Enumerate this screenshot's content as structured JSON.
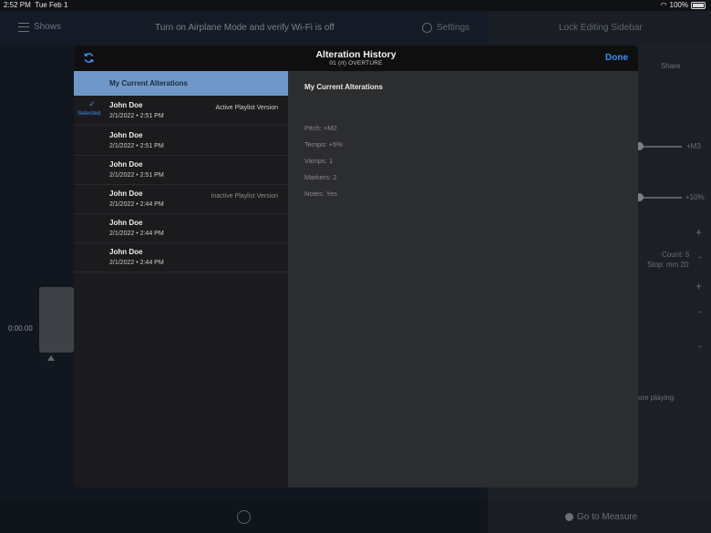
{
  "status": {
    "time": "2:52 PM",
    "date": "Tue Feb 1",
    "battery": "100%"
  },
  "topbar": {
    "shows_label": "Shows",
    "warning": "Turn on Airplane Mode and verify Wi-Fi is off",
    "settings_label": "Settings",
    "lock_label": "Lock Editing Sidebar"
  },
  "background": {
    "time_code": "0:00.00",
    "share_label": "Share",
    "pitch_value": "+M3",
    "tempo_value": "+10%",
    "count_label": "Count:",
    "count_value": "5",
    "stop_label": "Stop:",
    "stop_value": "mm 20",
    "before_playing": "ore playing",
    "go_to_measure": "Go to Measure"
  },
  "modal": {
    "title": "Alteration History",
    "subtitle": "01 (rt) OVERTURE",
    "done_label": "Done",
    "current_label": "My Current Alterations",
    "selected_label": "Selected",
    "rows": [
      {
        "name": "John Doe",
        "date": "2/1/2022 • 2:51 PM",
        "tag": "Active Playlist Version"
      },
      {
        "name": "John Doe",
        "date": "2/1/2022 • 2:51 PM",
        "tag": ""
      },
      {
        "name": "John Doe",
        "date": "2/1/2022 • 2:51 PM",
        "tag": ""
      },
      {
        "name": "John Doe",
        "date": "2/1/2022 • 2:44 PM",
        "tag": "Inactive Playlist Version"
      },
      {
        "name": "John Doe",
        "date": "2/1/2022 • 2:44 PM",
        "tag": ""
      },
      {
        "name": "John Doe",
        "date": "2/1/2022 • 2:44 PM",
        "tag": ""
      }
    ],
    "detail": {
      "title": "My Current Alterations",
      "pitch": "Pitch: +M2",
      "tempo": "Tempo: +5%",
      "vamps": "Vamps: 1",
      "markers": "Markers: 2",
      "notes": "Notes: Yes"
    }
  }
}
